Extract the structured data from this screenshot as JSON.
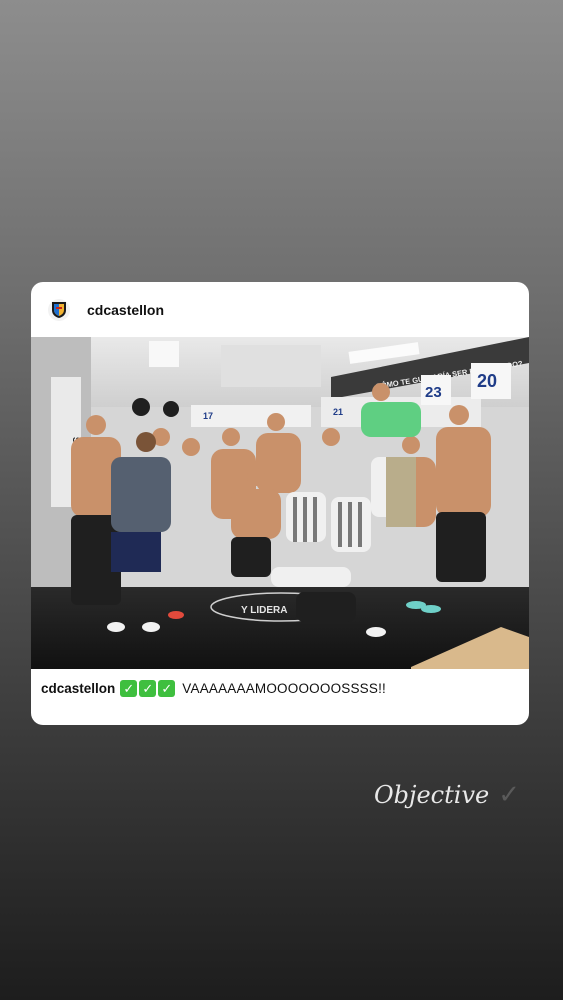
{
  "post": {
    "username": "cdcastellon",
    "caption_user": "cdcastellon",
    "caption_emojis": [
      "✓",
      "✓",
      "✓"
    ],
    "caption_text": "VAAAAAAAMOOOOOOOSSSS!!",
    "photo_texts": {
      "banner": "CÓMO TE GUSTARÍA SER RECORDADO?",
      "locker_numbers": [
        "20",
        "23",
        "21",
        "17"
      ],
      "floor_text": "Y LIDERA",
      "wall_text": "SISTEMA"
    }
  },
  "sticker": {
    "text": "Objective",
    "icon": "check-mark-icon"
  },
  "colors": {
    "emoji_green": "#3fbf3f",
    "card_bg": "#ffffff"
  }
}
